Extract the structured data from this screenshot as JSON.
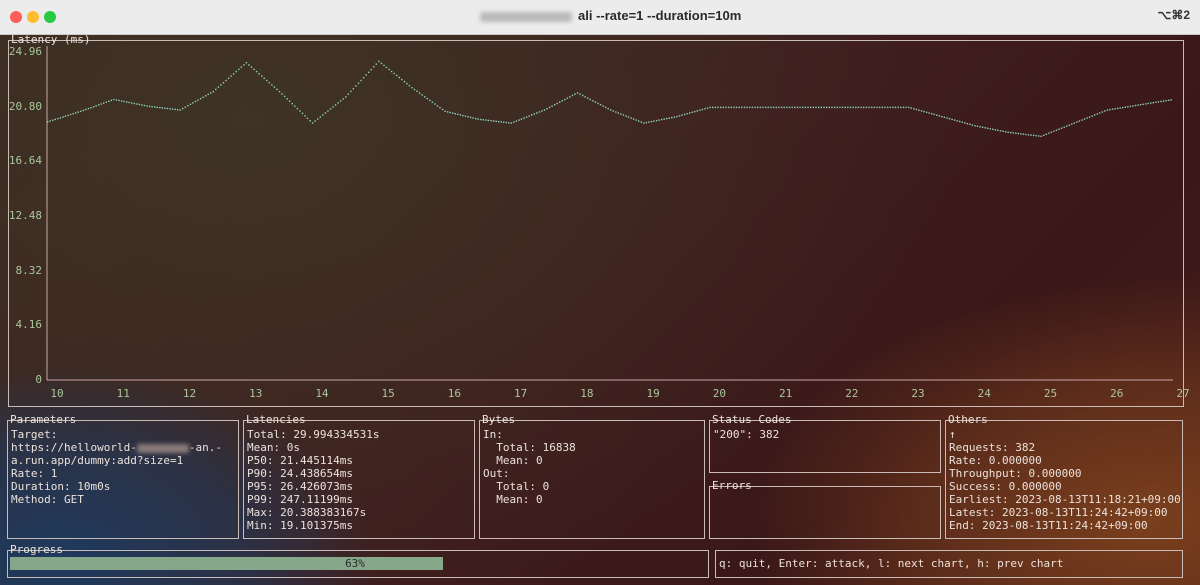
{
  "window": {
    "title": "ali --rate=1 --duration=10m",
    "shortcut": "⌥⌘2"
  },
  "chart_panel": {
    "title": "Latency (ms)"
  },
  "chart_data": {
    "type": "line",
    "title": "Latency (ms)",
    "ylim": [
      0,
      24.96
    ],
    "xlim": [
      10,
      27
    ],
    "yticks": [
      "24.96",
      "20.80",
      "16.64",
      "12.48",
      "8.32",
      "4.16",
      "0"
    ],
    "xticks": [
      "10",
      "11",
      "12",
      "13",
      "14",
      "15",
      "16",
      "17",
      "18",
      "19",
      "20",
      "21",
      "22",
      "23",
      "24",
      "25",
      "26",
      "27"
    ],
    "series": [
      {
        "color": "#8fd3c0",
        "x": [
          10.0,
          10.5,
          11.0,
          11.5,
          12.0,
          12.5,
          13.0,
          13.5,
          14.0,
          14.5,
          15.0,
          15.5,
          16.0,
          16.5,
          17.0,
          17.5,
          18.0,
          18.5,
          19.0,
          19.5,
          20.0,
          21.0,
          22.0,
          23.0,
          23.5,
          24.0,
          24.5,
          25.0,
          25.5,
          26.0,
          26.5,
          27.0
        ],
        "y": [
          19.7,
          20.5,
          21.4,
          20.9,
          20.6,
          22.0,
          24.2,
          22.0,
          19.6,
          21.6,
          24.3,
          22.3,
          20.5,
          19.9,
          19.6,
          20.6,
          21.9,
          20.6,
          19.6,
          20.1,
          20.8,
          20.8,
          20.8,
          20.8,
          20.1,
          19.4,
          18.9,
          18.6,
          19.6,
          20.6,
          21.0,
          21.4
        ]
      }
    ]
  },
  "parameters": {
    "title": "Parameters",
    "target_label": "Target:",
    "url_prefix": "https://helloworld-",
    "url_mid": "-an.-",
    "url_line2": "a.run.app/dummy:add?size=1",
    "rate": "Rate: 1",
    "duration": "Duration: 10m0s",
    "method": "Method: GET"
  },
  "latencies": {
    "title": "Latencies",
    "lines": [
      "Total: 29.994334531s",
      "Mean: 0s",
      "P50: 21.445114ms",
      "P90: 24.438654ms",
      "P95: 26.426073ms",
      "P99: 247.11199ms",
      "Max: 20.388383167s",
      "Min: 19.101375ms"
    ]
  },
  "bytes": {
    "title": "Bytes",
    "lines": [
      "In:",
      "  Total: 16838",
      "  Mean: 0",
      "Out:",
      "  Total: 0",
      "  Mean: 0"
    ]
  },
  "status_codes": {
    "title": "Status Codes",
    "lines": [
      "\"200\": 382"
    ]
  },
  "errors": {
    "title": "Errors"
  },
  "others": {
    "title": "Others",
    "lines": [
      "↑",
      "Requests: 382",
      "Rate: 0.000000",
      "Throughput: 0.000000",
      "Success: 0.000000",
      "Earliest: 2023-08-13T11:18:21+09:00",
      "Latest: 2023-08-13T11:24:42+09:00",
      "End: 2023-08-13T11:24:42+09:00"
    ]
  },
  "progress": {
    "title": "Progress",
    "value": 0.63,
    "label": "63%"
  },
  "help": {
    "text": "q: quit, Enter: attack, l: next chart, h: prev chart"
  }
}
